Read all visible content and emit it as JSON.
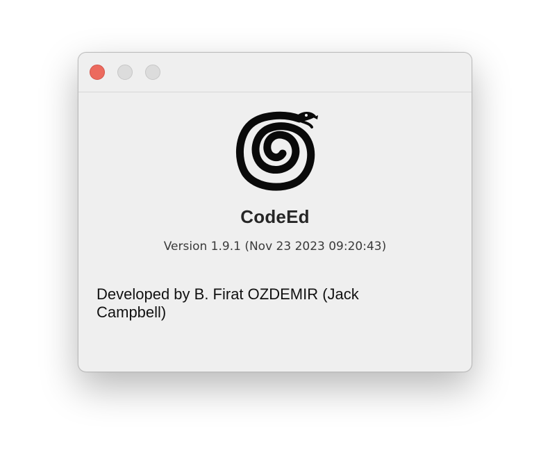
{
  "window": {
    "title": ""
  },
  "titlebar": {
    "buttons": {
      "close_color": "#ec6a5e",
      "minimize_color": "#dcdcdc",
      "zoom_color": "#dcdcdc"
    }
  },
  "about": {
    "app_icon": "spiral-snake-icon",
    "app_name": "CodeEd",
    "version": "Version 1.9.1 (Nov 23 2023 09:20:43)",
    "credits": "Developed by B. Firat OZDEMIR (Jack Campbell)"
  }
}
